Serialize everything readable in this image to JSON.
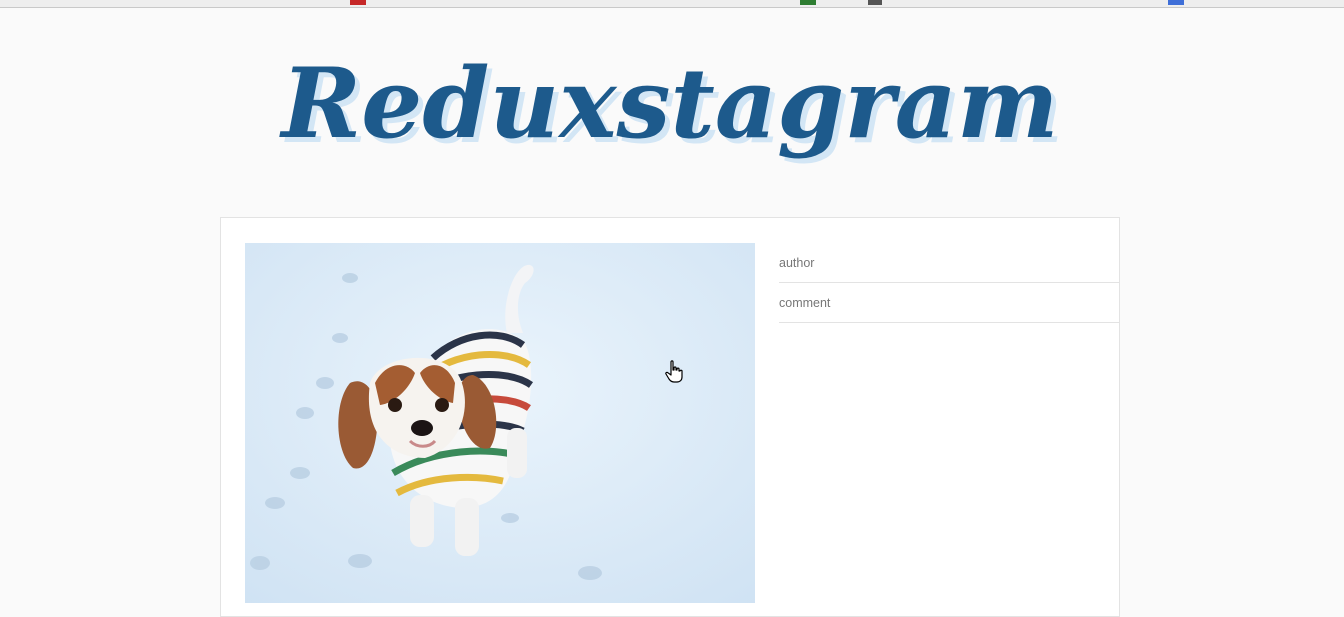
{
  "header": {
    "logo_text": "Reduxstagram",
    "logo_color": "#1d5a8c",
    "logo_shadow_color": "#d3e6f5"
  },
  "post": {
    "photo_icon": "dog-photo"
  },
  "comment_form": {
    "author_placeholder": "author",
    "comment_placeholder": "comment"
  },
  "cursor_icon": "hand-pointer-icon"
}
